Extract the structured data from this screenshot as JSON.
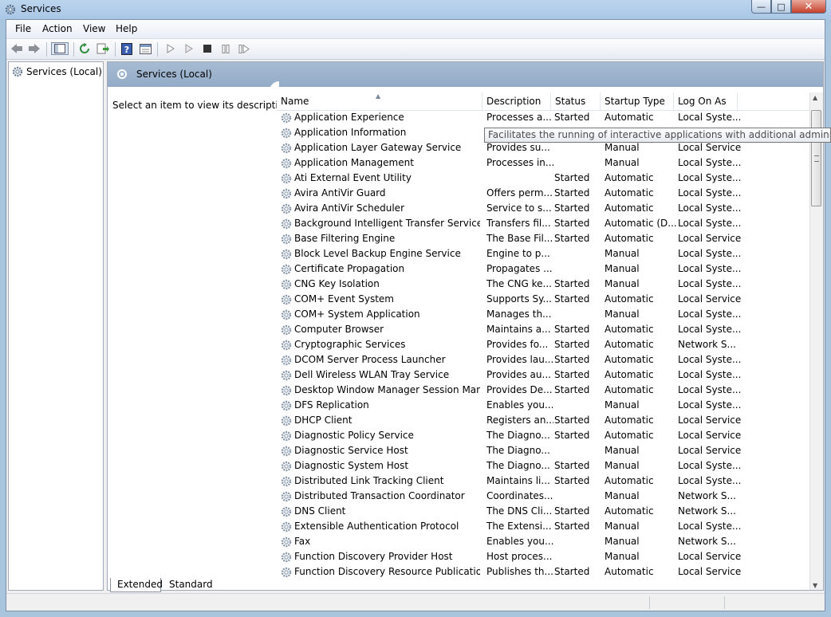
{
  "window": {
    "title": "Services"
  },
  "menu": [
    "File",
    "Action",
    "View",
    "Help"
  ],
  "tree": {
    "root": "Services (Local)"
  },
  "header": {
    "title": "Services (Local)"
  },
  "extended": {
    "description": "Select an item to view its description."
  },
  "columns": {
    "name": "Name",
    "description": "Description",
    "status": "Status",
    "startup": "Startup Type",
    "logon": "Log On As"
  },
  "tooltip": "Facilitates the running of interactive applications with additional administrative pr",
  "services": [
    {
      "name": "Application Experience",
      "desc": "Processes a...",
      "status": "Started",
      "startup": "Automatic",
      "logon": "Local Syste..."
    },
    {
      "name": "Application Information",
      "desc": "",
      "status": "",
      "startup": "",
      "logon": ""
    },
    {
      "name": "Application Layer Gateway Service",
      "desc": "Provides su...",
      "status": "",
      "startup": "Manual",
      "logon": "Local Service"
    },
    {
      "name": "Application Management",
      "desc": "Processes in...",
      "status": "",
      "startup": "Manual",
      "logon": "Local Syste..."
    },
    {
      "name": "Ati External Event Utility",
      "desc": "",
      "status": "Started",
      "startup": "Automatic",
      "logon": "Local Syste..."
    },
    {
      "name": "Avira AntiVir Guard",
      "desc": "Offers perm...",
      "status": "Started",
      "startup": "Automatic",
      "logon": "Local Syste..."
    },
    {
      "name": "Avira AntiVir Scheduler",
      "desc": "Service to s...",
      "status": "Started",
      "startup": "Automatic",
      "logon": "Local Syste..."
    },
    {
      "name": "Background Intelligent Transfer Service",
      "desc": "Transfers fil...",
      "status": "Started",
      "startup": "Automatic (D...",
      "logon": "Local Syste..."
    },
    {
      "name": "Base Filtering Engine",
      "desc": "The Base Fil...",
      "status": "Started",
      "startup": "Automatic",
      "logon": "Local Service"
    },
    {
      "name": "Block Level Backup Engine Service",
      "desc": "Engine to p...",
      "status": "",
      "startup": "Manual",
      "logon": "Local Syste..."
    },
    {
      "name": "Certificate Propagation",
      "desc": "Propagates ...",
      "status": "",
      "startup": "Manual",
      "logon": "Local Syste..."
    },
    {
      "name": "CNG Key Isolation",
      "desc": "The CNG ke...",
      "status": "Started",
      "startup": "Manual",
      "logon": "Local Syste..."
    },
    {
      "name": "COM+ Event System",
      "desc": "Supports Sy...",
      "status": "Started",
      "startup": "Automatic",
      "logon": "Local Service"
    },
    {
      "name": "COM+ System Application",
      "desc": "Manages th...",
      "status": "",
      "startup": "Manual",
      "logon": "Local Syste..."
    },
    {
      "name": "Computer Browser",
      "desc": "Maintains a...",
      "status": "Started",
      "startup": "Automatic",
      "logon": "Local Syste..."
    },
    {
      "name": "Cryptographic Services",
      "desc": "Provides fo...",
      "status": "Started",
      "startup": "Automatic",
      "logon": "Network S..."
    },
    {
      "name": "DCOM Server Process Launcher",
      "desc": "Provides lau...",
      "status": "Started",
      "startup": "Automatic",
      "logon": "Local Syste..."
    },
    {
      "name": "Dell Wireless WLAN Tray Service",
      "desc": "Provides au...",
      "status": "Started",
      "startup": "Automatic",
      "logon": "Local Syste..."
    },
    {
      "name": "Desktop Window Manager Session Manager",
      "desc": "Provides De...",
      "status": "Started",
      "startup": "Automatic",
      "logon": "Local Syste..."
    },
    {
      "name": "DFS Replication",
      "desc": "Enables you...",
      "status": "",
      "startup": "Manual",
      "logon": "Local Syste..."
    },
    {
      "name": "DHCP Client",
      "desc": "Registers an...",
      "status": "Started",
      "startup": "Automatic",
      "logon": "Local Service"
    },
    {
      "name": "Diagnostic Policy Service",
      "desc": "The Diagno...",
      "status": "Started",
      "startup": "Automatic",
      "logon": "Local Service"
    },
    {
      "name": "Diagnostic Service Host",
      "desc": "The Diagno...",
      "status": "",
      "startup": "Manual",
      "logon": "Local Service"
    },
    {
      "name": "Diagnostic System Host",
      "desc": "The Diagno...",
      "status": "Started",
      "startup": "Manual",
      "logon": "Local Syste..."
    },
    {
      "name": "Distributed Link Tracking Client",
      "desc": "Maintains li...",
      "status": "Started",
      "startup": "Automatic",
      "logon": "Local Syste..."
    },
    {
      "name": "Distributed Transaction Coordinator",
      "desc": "Coordinates...",
      "status": "",
      "startup": "Manual",
      "logon": "Network S..."
    },
    {
      "name": "DNS Client",
      "desc": "The DNS Cli...",
      "status": "Started",
      "startup": "Automatic",
      "logon": "Network S..."
    },
    {
      "name": "Extensible Authentication Protocol",
      "desc": "The Extensi...",
      "status": "Started",
      "startup": "Manual",
      "logon": "Local Syste..."
    },
    {
      "name": "Fax",
      "desc": "Enables you...",
      "status": "",
      "startup": "Manual",
      "logon": "Network S..."
    },
    {
      "name": "Function Discovery Provider Host",
      "desc": "Host proces...",
      "status": "",
      "startup": "Manual",
      "logon": "Local Service"
    },
    {
      "name": "Function Discovery Resource Publication",
      "desc": "Publishes th...",
      "status": "Started",
      "startup": "Automatic",
      "logon": "Local Service"
    }
  ],
  "tabs": {
    "extended": "Extended",
    "standard": "Standard"
  }
}
